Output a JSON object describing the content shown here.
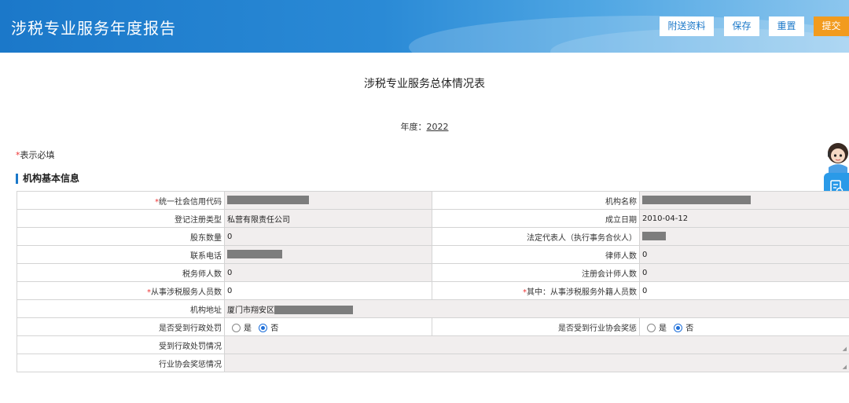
{
  "header": {
    "title": "涉税专业服务年度报告",
    "buttons": {
      "attach": "附送资料",
      "save": "保存",
      "reset": "重置",
      "submit": "提交"
    }
  },
  "main_title": "涉税专业服务总体情况表",
  "year_label": "年度：",
  "year_value": "2022",
  "required_star": "*",
  "required_note": "表示必填",
  "section_title": "机构基本信息",
  "fields": {
    "credit_code_label": "统一社会信用代码",
    "org_name_label": "机构名称",
    "reg_type_label": "登记注册类型",
    "reg_type_value": "私营有限责任公司",
    "found_date_label": "成立日期",
    "found_date_value": "2010-04-12",
    "shareholders_label": "股东数量",
    "shareholders_value": "0",
    "legal_rep_label": "法定代表人（执行事务合伙人）",
    "phone_label": "联系电话",
    "lawyers_label": "律师人数",
    "lawyers_value": "0",
    "tax_agents_label": "税务师人数",
    "tax_agents_value": "0",
    "cpa_label": "注册会计师人数",
    "cpa_value": "0",
    "staff_label": "从事涉税服务人员数",
    "staff_value": "0",
    "foreign_staff_label": "其中：从事涉税服务外籍人员数",
    "foreign_staff_value": "0",
    "address_label": "机构地址",
    "address_value": "厦门市翔安区",
    "penalty_label": "是否受到行政处罚",
    "award_label": "是否受到行业协会奖惩",
    "yes": "是",
    "no": "否",
    "penalty_detail_label": "受到行政处罚情况",
    "award_detail_label": "行业协会奖惩情况"
  },
  "colors": {
    "header_blue": "#1b78c9",
    "submit_orange": "#f29b1e",
    "required_red": "#e33"
  }
}
